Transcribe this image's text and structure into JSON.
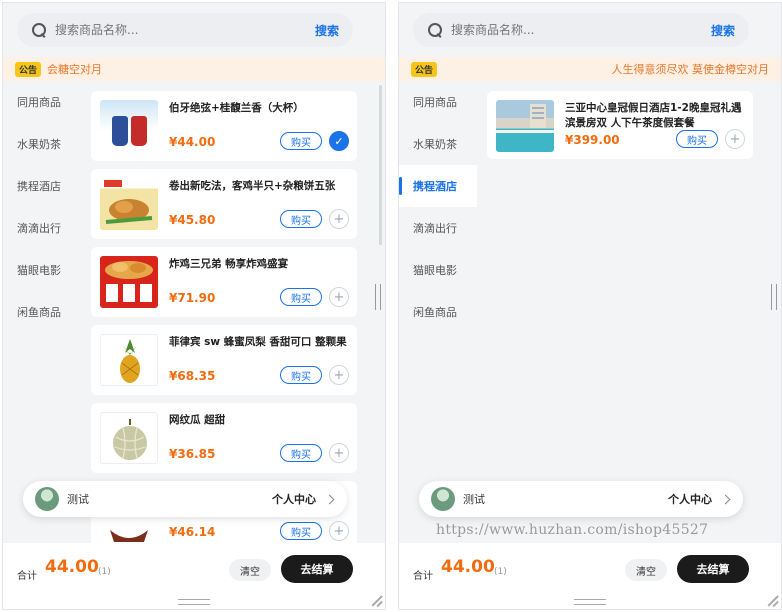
{
  "search": {
    "placeholder": "搜索商品名称...",
    "button": "搜索"
  },
  "notice": {
    "tag": "公告",
    "left_text": "会糖空对月",
    "right_text": "人生得意须尽欢 莫使金樽空对月"
  },
  "categories": [
    "同用商品",
    "水果奶茶",
    "携程酒店",
    "滴滴出行",
    "猫眼电影",
    "闲鱼商品"
  ],
  "left_panel": {
    "active_category": "同用商品",
    "products": [
      {
        "name": "伯牙绝弦+桂馥兰香（大杯）",
        "price": "¥44.00",
        "buy": "购买",
        "selected": true
      },
      {
        "name": "卷出新吃法，客鸡半只+杂粮饼五张",
        "price": "¥45.80",
        "buy": "购买",
        "selected": false
      },
      {
        "name": "炸鸡三兄弟 畅享炸鸡盛宴",
        "price": "¥71.90",
        "buy": "购买",
        "selected": false
      },
      {
        "name": "菲律宾 sw 蜂蜜凤梨 香甜可口 整颗果",
        "price": "¥68.35",
        "buy": "购买",
        "selected": false
      },
      {
        "name": "网纹瓜 超甜",
        "price": "¥36.85",
        "buy": "购买",
        "selected": false
      },
      {
        "name": "",
        "price": "¥46.14",
        "buy": "购买",
        "selected": false
      }
    ],
    "footer": {
      "total_label": "合计",
      "total_amount": "44.00",
      "count": "(1)",
      "clear": "清空",
      "checkout": "去结算"
    }
  },
  "right_panel": {
    "active_category": "携程酒店",
    "products": [
      {
        "name": "三亚中心皇冠假日酒店1-2晚皇冠礼遇滨景房双 人下午茶度假套餐",
        "price": "¥399.00",
        "buy": "购买",
        "selected": false
      }
    ],
    "footer": {
      "total_label": "合计",
      "total_amount": "44.00",
      "count": "(1)",
      "clear": "清空",
      "checkout": "去结算"
    }
  },
  "user": {
    "name": "测试",
    "center_label": "个人中心"
  },
  "watermark": "https://www.huzhan.com/ishop45527",
  "icons": {
    "search": "search-icon",
    "add": "plus-icon",
    "check": "check-icon",
    "chevron": "chevron-right-icon",
    "avatar": "avatar"
  },
  "colors": {
    "accent": "#1a73e8",
    "price": "#f26b0f",
    "checkout_bg": "#1b1b1b",
    "notice_bg": "#fdf0e4"
  }
}
